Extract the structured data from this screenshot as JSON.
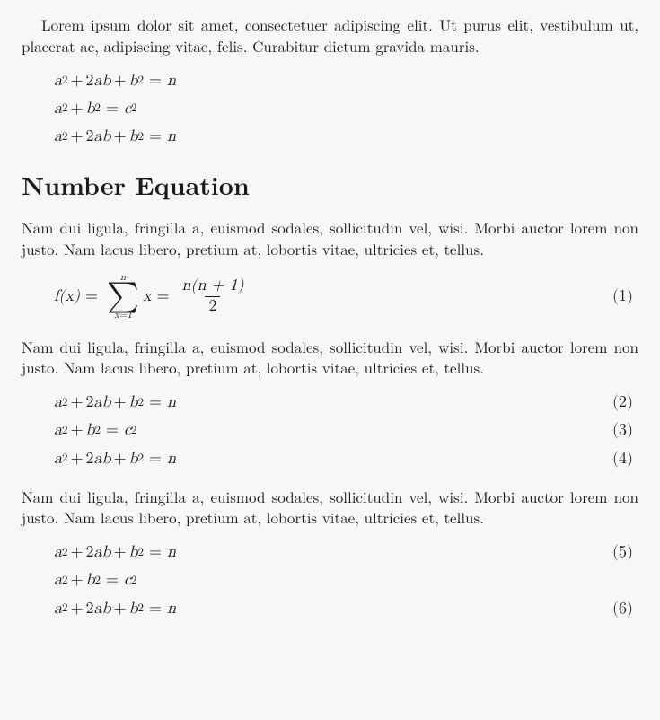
{
  "para1": "Lorem ipsum dolor sit amet, consectetuer adipiscing elit. Ut purus elit, vestibulum ut, placerat ac, adipiscing vitae, felis. Curabitur dictum gravida mauris.",
  "heading": "Number Equation",
  "para2": "Nam dui ligula, fringilla a, euismod sodales, sollicitudin vel, wisi. Morbi auctor lorem non justo. Nam lacus libero, pretium at, lobortis vitae, ultricies et, tellus.",
  "para3": "Nam dui ligula, fringilla a, euismod sodales, sollicitudin vel, wisi. Morbi auctor lorem non justo. Nam lacus libero, pretium at, lobortis vitae, ultricies et, tellus.",
  "para4": "Nam dui ligula, fringilla a, euismod sodales, sollicitudin vel, wisi. Morbi auctor lorem non justo. Nam lacus libero, pretium at, lobortis vitae, ultricies et, tellus.",
  "eq": {
    "a_long": [
      "a",
      "2",
      "+",
      "2",
      "a",
      "b",
      "+",
      "b",
      "2",
      "=",
      "n"
    ],
    "a_pyth": [
      "a",
      "2",
      "+",
      "b",
      "2",
      "=",
      "c",
      "2"
    ],
    "fx_lhs": "f(x)",
    "sum_top": "n",
    "sum_bot": "x=1",
    "sum_body": "x",
    "frac_num": "n(n + 1)",
    "frac_den": "2"
  },
  "labels": {
    "n1": "(1)",
    "n2": "(2)",
    "n3": "(3)",
    "n4": "(4)",
    "n5": "(5)",
    "n6": "(6)"
  }
}
